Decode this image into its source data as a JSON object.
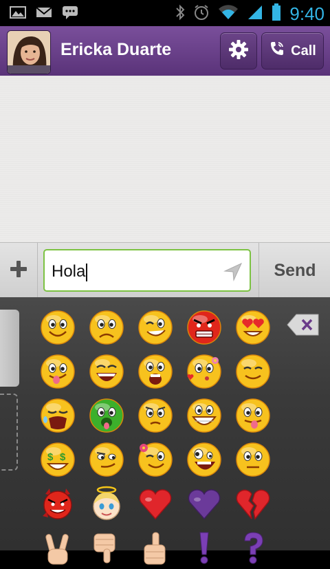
{
  "statusbar": {
    "time": "9:40",
    "icons": [
      "picture-icon",
      "gmail-icon",
      "message-icon",
      "bluetooth-icon",
      "alarm-icon",
      "wifi-icon",
      "battery-icon"
    ]
  },
  "header": {
    "contact_name": "Ericka Duarte",
    "call_label": "Call",
    "accent": "#5a3379"
  },
  "composer": {
    "text": "Hola",
    "send_label": "Send",
    "field_border": "#7cc242"
  },
  "emoji_panel": {
    "rows": [
      [
        "smile",
        "sad",
        "wink",
        "angry",
        "heart-eyes"
      ],
      [
        "tongue-wink",
        "laughing",
        "shocked",
        "kissing",
        "content"
      ],
      [
        "crying",
        "sick",
        "worried",
        "grinning",
        "silly-tongue"
      ],
      [
        "money-eyes",
        "smirk",
        "flower-wink",
        "crazy",
        "neutral"
      ],
      [
        "devil",
        "angel",
        "red-heart",
        "purple-heart",
        "broken-heart"
      ],
      [
        "peace",
        "thumbs-down",
        "thumbs-up",
        "exclamation",
        "question"
      ]
    ]
  }
}
